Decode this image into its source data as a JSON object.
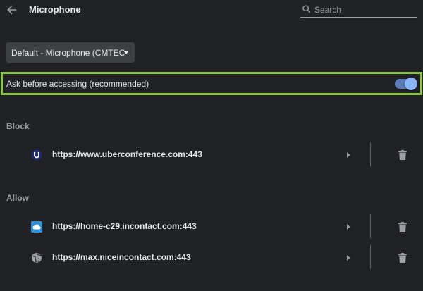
{
  "header": {
    "title": "Microphone",
    "search_placeholder": "Search",
    "search_value": ""
  },
  "device_select": {
    "value": "Default - Microphone (CMTEC"
  },
  "ask": {
    "label": "Ask before accessing (recommended)",
    "enabled": true
  },
  "block": {
    "label": "Block",
    "sites": [
      {
        "url": "https://www.uberconference.com:443",
        "icon": "uberconference-icon"
      }
    ]
  },
  "allow": {
    "label": "Allow",
    "sites": [
      {
        "url": "https://home-c29.incontact.com:443",
        "icon": "cloud-favicon-icon"
      },
      {
        "url": "https://max.niceincontact.com:443",
        "icon": "globe-icon"
      }
    ]
  },
  "colors": {
    "background": "#202124",
    "highlight_border": "#8cc63f",
    "toggle_knob": "#8ab4f8",
    "toggle_track": "#5b7bb6"
  }
}
